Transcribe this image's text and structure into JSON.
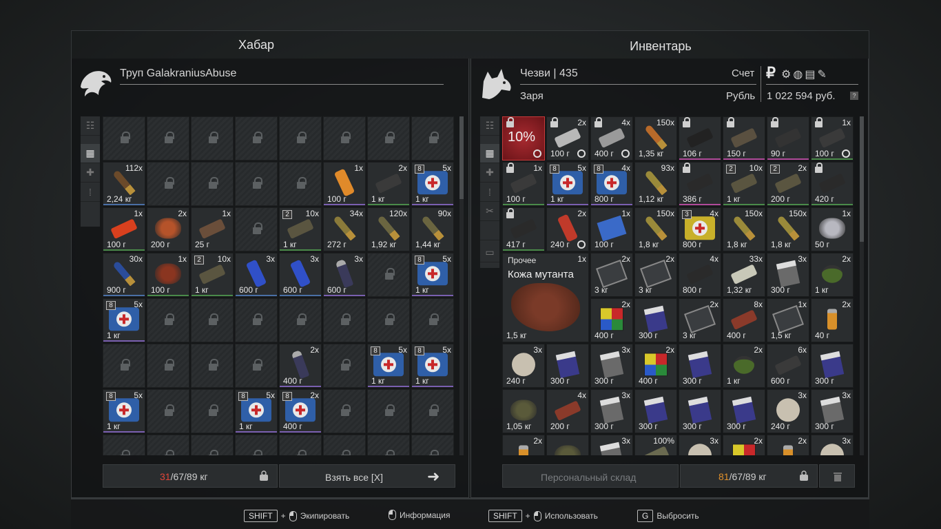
{
  "loot": {
    "title": "Хабар",
    "owner": "Труп GalakraniusAbuse",
    "weight_current": "31",
    "weight_rest": "/67/89 кг",
    "take_all": "Взять все [X]",
    "items": [
      {
        "r": 1,
        "c": 0,
        "w": 1,
        "h": 1,
        "cnt": "112x",
        "wt": "2,24 кг",
        "icon": "rifle-ammo-icon",
        "col": "#6b4a2a",
        "bar": "#4a6fa5"
      },
      {
        "r": 1,
        "c": 5,
        "w": 1,
        "h": 1,
        "cnt": "1x",
        "wt": "100 г",
        "icon": "battery-icon",
        "col": "#e08a2a",
        "bar": "#7a5fb0"
      },
      {
        "r": 1,
        "c": 6,
        "w": 1,
        "h": 1,
        "cnt": "2x",
        "wt": "1 кг",
        "icon": "device-icon",
        "col": "#3a3a3a",
        "bar": "#4a8a4a"
      },
      {
        "r": 1,
        "c": 7,
        "w": 1,
        "h": 1,
        "cnt": "5x",
        "wt": "1 кг",
        "icon": "medkit-icon",
        "col": "#2f5fa8",
        "lvl": "8",
        "bar": "#7a5fb0"
      },
      {
        "r": 2,
        "c": 0,
        "w": 1,
        "h": 1,
        "cnt": "1x",
        "wt": "100 г",
        "icon": "gloves-icon",
        "col": "#d8401e",
        "bar": "#4a8a4a"
      },
      {
        "r": 2,
        "c": 1,
        "w": 1,
        "h": 1,
        "cnt": "2x",
        "wt": "200 г",
        "icon": "food-icon",
        "col": "#b5532a"
      },
      {
        "r": 2,
        "c": 2,
        "w": 1,
        "h": 1,
        "cnt": "1x",
        "wt": "25 г",
        "icon": "bread-icon",
        "col": "#6a4e3a"
      },
      {
        "r": 2,
        "c": 4,
        "w": 1,
        "h": 1,
        "cnt": "10x",
        "wt": "1 кг",
        "icon": "bandage-icon",
        "col": "#5a5540",
        "lvl": "2",
        "bar": "#4a8a4a"
      },
      {
        "r": 2,
        "c": 5,
        "w": 1,
        "h": 1,
        "cnt": "34x",
        "wt": "272 г",
        "icon": "incendiary-ammo-icon",
        "col": "#8a7a3a"
      },
      {
        "r": 2,
        "c": 6,
        "w": 1,
        "h": 1,
        "cnt": "120x",
        "wt": "1,92 кг",
        "icon": "rifle-ammo-icon",
        "col": "#6a6540"
      },
      {
        "r": 2,
        "c": 7,
        "w": 1,
        "h": 1,
        "cnt": "90x",
        "wt": "1,44 кг",
        "icon": "rifle-ammo-icon",
        "col": "#6a6540"
      },
      {
        "r": 3,
        "c": 0,
        "w": 1,
        "h": 1,
        "cnt": "30x",
        "wt": "900 г",
        "icon": "shotgun-shell-icon",
        "col": "#2a4c9a",
        "bar": "#4a6fa5"
      },
      {
        "r": 3,
        "c": 1,
        "w": 1,
        "h": 1,
        "cnt": "1x",
        "wt": "100 г",
        "icon": "meat-icon",
        "col": "#8a3520",
        "bar": "#4a8a4a"
      },
      {
        "r": 3,
        "c": 2,
        "w": 1,
        "h": 1,
        "cnt": "10x",
        "wt": "1 кг",
        "icon": "bandage-icon",
        "col": "#5a5540",
        "lvl": "2",
        "bar": "#4a8a4a"
      },
      {
        "r": 3,
        "c": 3,
        "w": 1,
        "h": 1,
        "cnt": "3x",
        "wt": "600 г",
        "icon": "energy-drink-icon",
        "col": "#3050c8",
        "bar": "#4a6fa5"
      },
      {
        "r": 3,
        "c": 4,
        "w": 1,
        "h": 1,
        "cnt": "3x",
        "wt": "600 г",
        "icon": "energy-drink-icon",
        "col": "#3050c8",
        "bar": "#4a6fa5"
      },
      {
        "r": 3,
        "c": 5,
        "w": 1,
        "h": 1,
        "cnt": "3x",
        "wt": "600 г",
        "icon": "bottle-icon",
        "col": "#3a3a5a",
        "bar": "#7a5fb0"
      },
      {
        "r": 3,
        "c": 7,
        "w": 1,
        "h": 1,
        "cnt": "5x",
        "wt": "1 кг",
        "icon": "medkit-icon",
        "col": "#2f5fa8",
        "lvl": "8",
        "bar": "#7a5fb0"
      },
      {
        "r": 4,
        "c": 0,
        "w": 1,
        "h": 1,
        "cnt": "5x",
        "wt": "1 кг",
        "icon": "medkit-icon",
        "col": "#2f5fa8",
        "lvl": "8",
        "bar": "#7a5fb0"
      },
      {
        "r": 5,
        "c": 4,
        "w": 1,
        "h": 1,
        "cnt": "2x",
        "wt": "400 г",
        "icon": "bottle-icon",
        "col": "#3a3a5a",
        "bar": "#7a5fb0"
      },
      {
        "r": 5,
        "c": 6,
        "w": 1,
        "h": 1,
        "cnt": "5x",
        "wt": "1 кг",
        "icon": "medkit-icon",
        "col": "#2f5fa8",
        "lvl": "8",
        "bar": "#7a5fb0"
      },
      {
        "r": 5,
        "c": 7,
        "w": 1,
        "h": 1,
        "cnt": "5x",
        "wt": "1 кг",
        "icon": "medkit-icon",
        "col": "#2f5fa8",
        "lvl": "8",
        "bar": "#7a5fb0"
      },
      {
        "r": 6,
        "c": 0,
        "w": 1,
        "h": 1,
        "cnt": "5x",
        "wt": "1 кг",
        "icon": "medkit-icon",
        "col": "#2f5fa8",
        "lvl": "8",
        "bar": "#7a5fb0"
      },
      {
        "r": 6,
        "c": 3,
        "w": 1,
        "h": 1,
        "cnt": "5x",
        "wt": "1 кг",
        "icon": "medkit-icon",
        "col": "#2f5fa8",
        "lvl": "8",
        "bar": "#7a5fb0"
      },
      {
        "r": 6,
        "c": 4,
        "w": 1,
        "h": 1,
        "cnt": "2x",
        "wt": "400 г",
        "icon": "medkit-icon",
        "col": "#2f5fa8",
        "lvl": "8",
        "bar": "#7a5fb0"
      }
    ],
    "locked": [
      [
        0,
        0
      ],
      [
        0,
        1
      ],
      [
        0,
        2
      ],
      [
        0,
        3
      ],
      [
        0,
        4
      ],
      [
        0,
        5
      ],
      [
        0,
        6
      ],
      [
        0,
        7
      ],
      [
        1,
        1
      ],
      [
        1,
        2
      ],
      [
        1,
        3
      ],
      [
        1,
        4
      ],
      [
        2,
        3
      ],
      [
        3,
        6
      ],
      [
        4,
        1
      ],
      [
        4,
        2
      ],
      [
        4,
        3
      ],
      [
        4,
        4
      ],
      [
        4,
        5
      ],
      [
        4,
        6
      ],
      [
        4,
        7
      ],
      [
        5,
        0
      ],
      [
        5,
        1
      ],
      [
        5,
        2
      ],
      [
        5,
        3
      ],
      [
        5,
        5
      ],
      [
        6,
        1
      ],
      [
        6,
        2
      ],
      [
        6,
        5
      ],
      [
        6,
        6
      ],
      [
        6,
        7
      ],
      [
        7,
        0
      ],
      [
        7,
        1
      ],
      [
        7,
        2
      ],
      [
        7,
        3
      ],
      [
        7,
        4
      ],
      [
        7,
        5
      ],
      [
        7,
        6
      ],
      [
        7,
        7
      ]
    ]
  },
  "inventory": {
    "title": "Инвентарь",
    "char_name": "Чезви | 435",
    "faction": "Заря",
    "account_label": "Счет",
    "currency_label": "Рубль",
    "currency_symbol": "₽",
    "balance": "1 022 594 руб.",
    "help": "?",
    "weight_current": "81",
    "weight_rest": "/67/89 кг",
    "stash_button": "Персональный склад",
    "items": [
      {
        "r": 0,
        "c": 0,
        "w": 1,
        "h": 1,
        "cnt": "",
        "wt": "",
        "icon": "artifact-container-icon",
        "col": "#8a1e22",
        "big": "10%",
        "lock": true,
        "clock": true
      },
      {
        "r": 0,
        "c": 1,
        "w": 1,
        "h": 1,
        "cnt": "2x",
        "wt": "100 г",
        "icon": "syringe-icon",
        "col": "#b8b8b8",
        "lock": true,
        "clock": true
      },
      {
        "r": 0,
        "c": 2,
        "w": 1,
        "h": 1,
        "cnt": "4x",
        "wt": "400 г",
        "icon": "injector-icon",
        "col": "#9a9a9a",
        "lock": true,
        "clock": true
      },
      {
        "r": 0,
        "c": 3,
        "w": 1,
        "h": 1,
        "cnt": "150x",
        "wt": "1,35 кг",
        "icon": "pistol-ammo-icon",
        "col": "#b86a2a"
      },
      {
        "r": 0,
        "c": 4,
        "w": 1,
        "h": 1,
        "cnt": "",
        "wt": "106 г",
        "icon": "suppressor-icon",
        "col": "#222",
        "lock": true,
        "bar": "#b04a9a"
      },
      {
        "r": 0,
        "c": 5,
        "w": 1,
        "h": 1,
        "cnt": "",
        "wt": "150 г",
        "icon": "grip-icon",
        "col": "#5a5040",
        "lock": true,
        "bar": "#b04a9a"
      },
      {
        "r": 0,
        "c": 6,
        "w": 1,
        "h": 1,
        "cnt": "",
        "wt": "90 г",
        "icon": "mount-icon",
        "col": "#333",
        "lock": true,
        "bar": "#b04a9a"
      },
      {
        "r": 0,
        "c": 7,
        "w": 1,
        "h": 1,
        "cnt": "1x",
        "wt": "100 г",
        "icon": "laser-icon",
        "col": "#3a3a3a",
        "lock": true,
        "clock": true,
        "bar": "#4a8a4a"
      },
      {
        "r": 1,
        "c": 0,
        "w": 1,
        "h": 1,
        "cnt": "1x",
        "wt": "100 г",
        "icon": "laser-icon",
        "col": "#3a3a3a",
        "lock": true,
        "bar": "#4a8a4a"
      },
      {
        "r": 1,
        "c": 1,
        "w": 1,
        "h": 1,
        "cnt": "5x",
        "wt": "1 кг",
        "icon": "medkit-icon",
        "col": "#2f5fa8",
        "lvl": "8",
        "bar": "#7a5fb0"
      },
      {
        "r": 1,
        "c": 2,
        "w": 1,
        "h": 1,
        "cnt": "4x",
        "wt": "800 г",
        "icon": "medkit-icon",
        "col": "#2f5fa8",
        "lvl": "8",
        "bar": "#7a5fb0"
      },
      {
        "r": 1,
        "c": 3,
        "w": 1,
        "h": 1,
        "cnt": "93x",
        "wt": "1,12 кг",
        "icon": "rifle-ammo-icon",
        "col": "#9a8a3a"
      },
      {
        "r": 1,
        "c": 4,
        "w": 1,
        "h": 1,
        "cnt": "",
        "wt": "386 г",
        "icon": "scope-icon",
        "col": "#2a2a2a",
        "lock": true,
        "bar": "#b04a9a"
      },
      {
        "r": 1,
        "c": 5,
        "w": 1,
        "h": 1,
        "cnt": "10x",
        "wt": "1 кг",
        "icon": "bandage-icon",
        "col": "#5a5540",
        "lvl": "2",
        "bar": "#4a8a4a"
      },
      {
        "r": 1,
        "c": 6,
        "w": 1,
        "h": 1,
        "cnt": "2x",
        "wt": "200 г",
        "icon": "bandage-icon",
        "col": "#5a5540",
        "lvl": "2",
        "bar": "#4a8a4a"
      },
      {
        "r": 1,
        "c": 7,
        "w": 1,
        "h": 1,
        "cnt": "",
        "wt": "420 г",
        "icon": "scope-icon",
        "col": "#2a2a2a",
        "lock": true,
        "bar": "#4a8a4a"
      },
      {
        "r": 2,
        "c": 0,
        "w": 1,
        "h": 1,
        "cnt": "",
        "wt": "417 г",
        "icon": "scope-icon",
        "col": "#2a2a2a",
        "lock": true,
        "bar": "#4a8a4a"
      },
      {
        "r": 2,
        "c": 1,
        "w": 1,
        "h": 1,
        "cnt": "2x",
        "wt": "240 г",
        "icon": "pills-icon",
        "col": "#c03a2a",
        "clock": true
      },
      {
        "r": 2,
        "c": 2,
        "w": 1,
        "h": 1,
        "cnt": "1x",
        "wt": "100 г",
        "icon": "book-icon",
        "col": "#3a6ac8"
      },
      {
        "r": 2,
        "c": 3,
        "w": 1,
        "h": 1,
        "cnt": "150x",
        "wt": "1,8 кг",
        "icon": "rifle-ammo-icon",
        "col": "#9a8a3a"
      },
      {
        "r": 2,
        "c": 4,
        "w": 1,
        "h": 1,
        "cnt": "4x",
        "wt": "800 г",
        "icon": "medkit-yellow-icon",
        "col": "#c8b02a",
        "lvl": "3"
      },
      {
        "r": 2,
        "c": 5,
        "w": 1,
        "h": 1,
        "cnt": "150x",
        "wt": "1,8 кг",
        "icon": "rifle-ammo-icon",
        "col": "#9a8a3a"
      },
      {
        "r": 2,
        "c": 6,
        "w": 1,
        "h": 1,
        "cnt": "150x",
        "wt": "1,8 кг",
        "icon": "rifle-ammo-icon",
        "col": "#9a8a3a"
      },
      {
        "r": 2,
        "c": 7,
        "w": 1,
        "h": 1,
        "cnt": "1x",
        "wt": "50 г",
        "icon": "artifact-icon",
        "col": "#b8b8c0"
      },
      {
        "r": 3,
        "c": 0,
        "w": 2,
        "h": 2,
        "cnt": "1x",
        "wt": "1,5 кг",
        "icon": "mutant-skin-icon",
        "col": "#7a3a28",
        "cat": "Прочее",
        "name": "Кожа мутанта"
      },
      {
        "r": 3,
        "c": 2,
        "w": 1,
        "h": 1,
        "cnt": "2x",
        "wt": "3 кг",
        "icon": "plate-icon",
        "col": "#3a3d40"
      },
      {
        "r": 3,
        "c": 3,
        "w": 1,
        "h": 1,
        "cnt": "2x",
        "wt": "3 кг",
        "icon": "plate-icon",
        "col": "#3a3d40"
      },
      {
        "r": 3,
        "c": 4,
        "w": 1,
        "h": 1,
        "cnt": "4x",
        "wt": "800 г",
        "icon": "part-icon",
        "col": "#2a2a2a"
      },
      {
        "r": 3,
        "c": 5,
        "w": 1,
        "h": 1,
        "cnt": "33x",
        "wt": "1,32 кг",
        "icon": "money-icon",
        "col": "#c8c8b8"
      },
      {
        "r": 3,
        "c": 6,
        "w": 1,
        "h": 1,
        "cnt": "3x",
        "wt": "300 г",
        "icon": "cigarettes-icon",
        "col": "#6a6a6a"
      },
      {
        "r": 3,
        "c": 7,
        "w": 1,
        "h": 1,
        "cnt": "2x",
        "wt": "1 кг",
        "icon": "grenade-icon",
        "col": "#4a6a2a"
      },
      {
        "r": 4,
        "c": 2,
        "w": 1,
        "h": 1,
        "cnt": "2x",
        "wt": "400 г",
        "icon": "cube-icon",
        "col": "#c8a02a"
      },
      {
        "r": 4,
        "c": 3,
        "w": 1,
        "h": 1,
        "cnt": "",
        "wt": "300 г",
        "icon": "cigarettes-icon",
        "col": "#3a3a8a"
      },
      {
        "r": 4,
        "c": 4,
        "w": 1,
        "h": 1,
        "cnt": "2x",
        "wt": "3 кг",
        "icon": "plate-icon",
        "col": "#3a3d40"
      },
      {
        "r": 4,
        "c": 5,
        "w": 1,
        "h": 1,
        "cnt": "8x",
        "wt": "400 г",
        "icon": "chip-icon",
        "col": "#8a3a2a"
      },
      {
        "r": 4,
        "c": 6,
        "w": 1,
        "h": 1,
        "cnt": "1x",
        "wt": "1,5 кг",
        "icon": "plate-icon",
        "col": "#3a3d40"
      },
      {
        "r": 4,
        "c": 7,
        "w": 1,
        "h": 1,
        "cnt": "2x",
        "wt": "40 г",
        "icon": "lighter-icon",
        "col": "#d8902a"
      },
      {
        "r": 5,
        "c": 0,
        "w": 1,
        "h": 1,
        "cnt": "3x",
        "wt": "240 г",
        "icon": "toilet-paper-icon",
        "col": "#c8c0b0"
      },
      {
        "r": 5,
        "c": 1,
        "w": 1,
        "h": 1,
        "cnt": "",
        "wt": "300 г",
        "icon": "cigarettes-icon",
        "col": "#3a3a8a"
      },
      {
        "r": 5,
        "c": 2,
        "w": 1,
        "h": 1,
        "cnt": "3x",
        "wt": "300 г",
        "icon": "cigarettes-icon",
        "col": "#6a6a6a"
      },
      {
        "r": 5,
        "c": 3,
        "w": 1,
        "h": 1,
        "cnt": "2x",
        "wt": "400 г",
        "icon": "cube-icon",
        "col": "#c8a02a"
      },
      {
        "r": 5,
        "c": 4,
        "w": 1,
        "h": 1,
        "cnt": "",
        "wt": "300 г",
        "icon": "cigarettes-icon",
        "col": "#3a3a8a"
      },
      {
        "r": 5,
        "c": 5,
        "w": 1,
        "h": 1,
        "cnt": "2x",
        "wt": "1 кг",
        "icon": "grenade-icon",
        "col": "#4a6a2a"
      },
      {
        "r": 5,
        "c": 6,
        "w": 1,
        "h": 1,
        "cnt": "6x",
        "wt": "600 г",
        "icon": "transistor-icon",
        "col": "#3a3a3a"
      },
      {
        "r": 5,
        "c": 7,
        "w": 1,
        "h": 1,
        "cnt": "",
        "wt": "300 г",
        "icon": "cigarettes-icon",
        "col": "#3a3a8a"
      },
      {
        "r": 6,
        "c": 0,
        "w": 1,
        "h": 1,
        "cnt": "",
        "wt": "1,05 кг",
        "icon": "moss-icon",
        "col": "#5a5a3a"
      },
      {
        "r": 6,
        "c": 1,
        "w": 1,
        "h": 1,
        "cnt": "4x",
        "wt": "200 г",
        "icon": "chip-icon",
        "col": "#8a3a2a"
      },
      {
        "r": 6,
        "c": 2,
        "w": 1,
        "h": 1,
        "cnt": "3x",
        "wt": "300 г",
        "icon": "cigarettes-icon",
        "col": "#6a6a6a"
      },
      {
        "r": 6,
        "c": 3,
        "w": 1,
        "h": 1,
        "cnt": "",
        "wt": "300 г",
        "icon": "cigarettes-icon",
        "col": "#3a3a8a"
      },
      {
        "r": 6,
        "c": 4,
        "w": 1,
        "h": 1,
        "cnt": "",
        "wt": "300 г",
        "icon": "cigarettes-icon",
        "col": "#3a3a8a"
      },
      {
        "r": 6,
        "c": 5,
        "w": 1,
        "h": 1,
        "cnt": "",
        "wt": "300 г",
        "icon": "cigarettes-icon",
        "col": "#3a3a8a"
      },
      {
        "r": 6,
        "c": 6,
        "w": 1,
        "h": 1,
        "cnt": "3x",
        "wt": "240 г",
        "icon": "toilet-paper-icon",
        "col": "#c8c0b0"
      },
      {
        "r": 6,
        "c": 7,
        "w": 1,
        "h": 1,
        "cnt": "3x",
        "wt": "300 г",
        "icon": "cigarettes-icon",
        "col": "#6a6a6a"
      },
      {
        "r": 7,
        "c": 0,
        "w": 1,
        "h": 1,
        "cnt": "2x",
        "wt": "",
        "icon": "lighter-icon",
        "col": "#d8902a"
      },
      {
        "r": 7,
        "c": 1,
        "w": 1,
        "h": 1,
        "cnt": "",
        "wt": "",
        "icon": "moss-icon",
        "col": "#5a5a3a"
      },
      {
        "r": 7,
        "c": 2,
        "w": 1,
        "h": 1,
        "cnt": "3x",
        "wt": "",
        "icon": "cigarettes-icon",
        "col": "#6a6a6a"
      },
      {
        "r": 7,
        "c": 3,
        "w": 1,
        "h": 1,
        "cnt": "100%",
        "wt": "",
        "icon": "bag-icon",
        "col": "#6a6a50"
      },
      {
        "r": 7,
        "c": 4,
        "w": 1,
        "h": 1,
        "cnt": "3x",
        "wt": "",
        "icon": "toilet-paper-icon",
        "col": "#c8c0b0"
      },
      {
        "r": 7,
        "c": 5,
        "w": 1,
        "h": 1,
        "cnt": "2x",
        "wt": "",
        "icon": "cube-icon",
        "col": "#c8a02a"
      },
      {
        "r": 7,
        "c": 6,
        "w": 1,
        "h": 1,
        "cnt": "2x",
        "wt": "",
        "icon": "lighter-icon",
        "col": "#d8902a"
      },
      {
        "r": 7,
        "c": 7,
        "w": 1,
        "h": 1,
        "cnt": "3x",
        "wt": "",
        "icon": "toilet-paper-icon",
        "col": "#c8c0b0"
      }
    ]
  },
  "hotkeys": {
    "shift": "SHIFT",
    "plus": "+",
    "equip": "Экипировать",
    "info": "Информация",
    "use": "Использовать",
    "g_key": "G",
    "drop": "Выбросить"
  }
}
